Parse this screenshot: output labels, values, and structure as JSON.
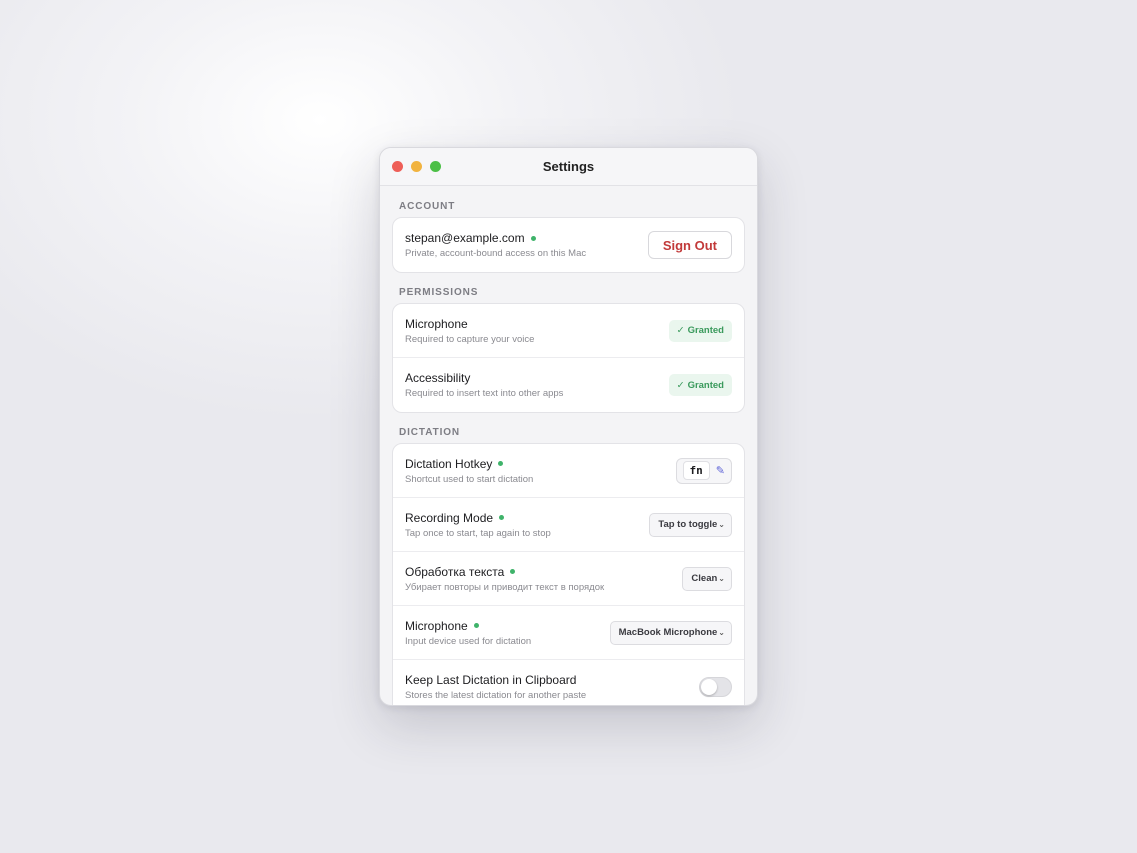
{
  "window": {
    "title": "Settings"
  },
  "account": {
    "section_label": "ACCOUNT",
    "email": "stepan@example.com",
    "status_color": "#3fb36a",
    "description": "Private, account-bound access on this Mac",
    "sign_out_label": "Sign Out"
  },
  "permissions": {
    "section_label": "PERMISSIONS",
    "items": [
      {
        "label": "Microphone",
        "description": "Required to capture your voice",
        "status": "Granted",
        "status_icon": "checkmark-icon"
      },
      {
        "label": "Accessibility",
        "description": "Required to insert text into other apps",
        "status": "Granted",
        "status_icon": "checkmark-icon"
      }
    ]
  },
  "dictation": {
    "section_label": "DICTATION",
    "hotkey": {
      "label": "Dictation Hotkey",
      "description": "Shortcut used to start dictation",
      "key": "fn",
      "edit_icon": "pencil-icon"
    },
    "recording_mode": {
      "label": "Recording Mode",
      "description": "Tap once to start, tap again to stop",
      "value": "Tap to toggle"
    },
    "text_processing": {
      "label": "Обработка текста",
      "description": "Убирает повторы и приводит текст в порядок",
      "value": "Clean"
    },
    "microphone": {
      "label": "Microphone",
      "description": "Input device used for dictation",
      "value": "MacBook Microphone"
    },
    "clipboard": {
      "label": "Keep Last Dictation in Clipboard",
      "description": "Stores the latest dictation for another paste",
      "enabled": false
    }
  },
  "glyphs": {
    "check": "✓",
    "chevron": "⌄",
    "pencil": "✎"
  }
}
